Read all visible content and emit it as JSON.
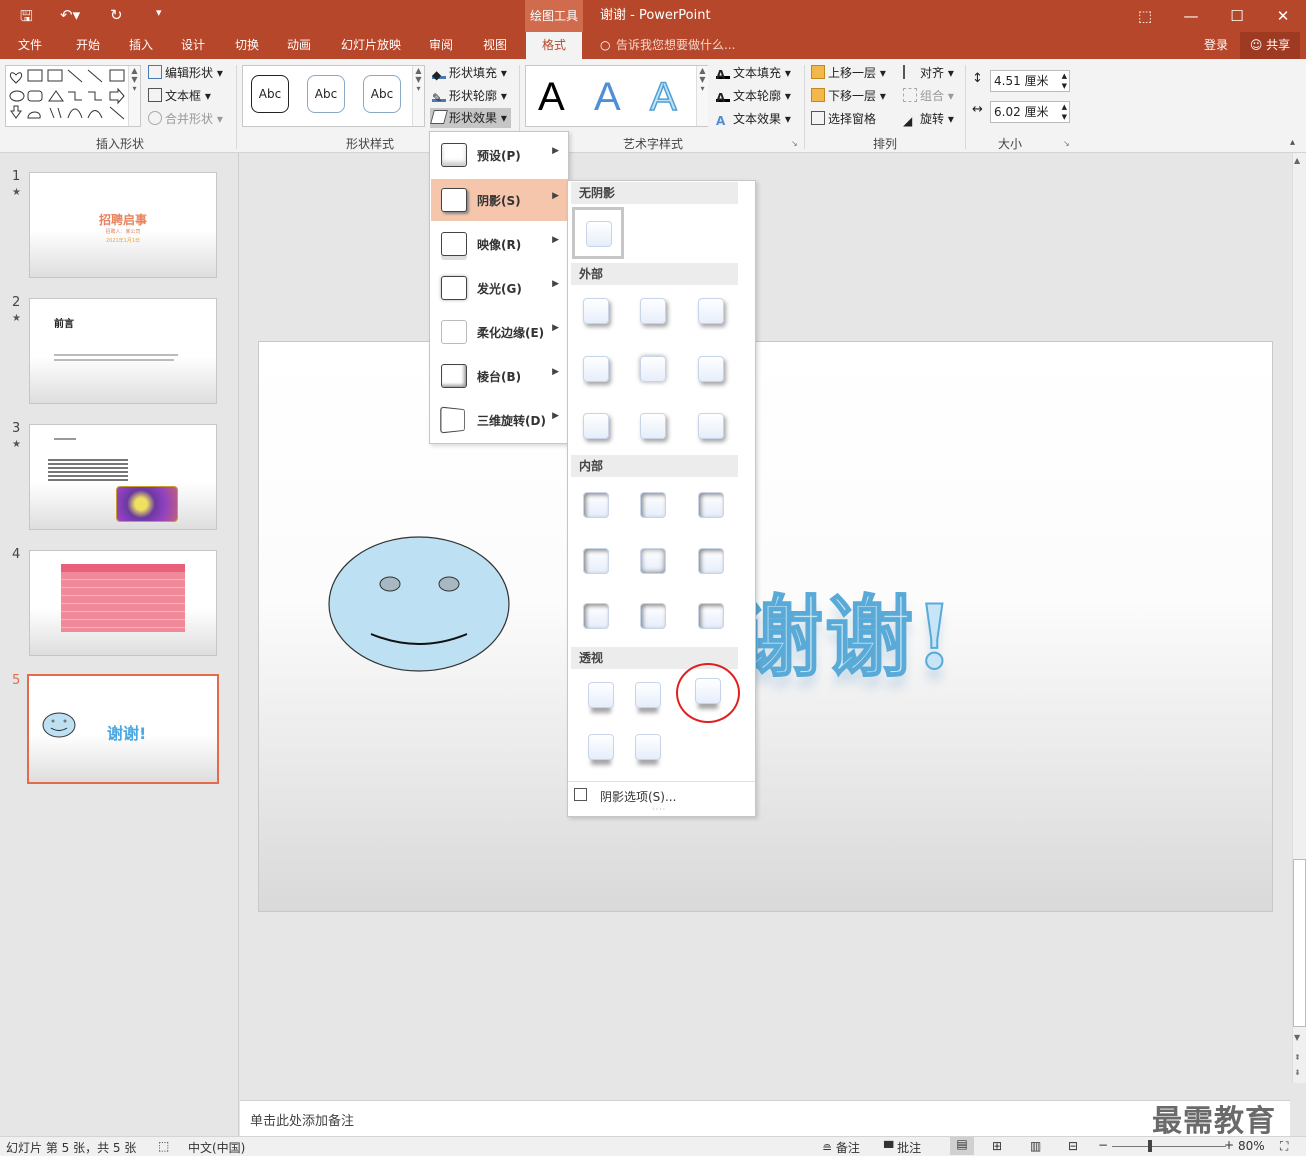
{
  "window": {
    "context_tool": "绘图工具",
    "title": "谢谢 - PowerPoint",
    "login": "登录",
    "share": "共享"
  },
  "tabs": [
    "文件",
    "开始",
    "插入",
    "设计",
    "切换",
    "动画",
    "幻灯片放映",
    "审阅",
    "视图",
    "格式"
  ],
  "active_tab": "格式",
  "tell_me": "告诉我您想要做什么...",
  "ribbon": {
    "insert_shapes": {
      "edit_shape": "编辑形状",
      "text_box": "文本框",
      "merge_shapes": "合并形状",
      "label": "插入形状"
    },
    "shape_styles": {
      "samples": [
        "Abc",
        "Abc",
        "Abc"
      ],
      "fill": "形状填充",
      "outline": "形状轮廓",
      "effects": "形状效果",
      "label": "形状样式"
    },
    "wordart": {
      "samples": [
        "A",
        "A",
        "A"
      ],
      "text_fill": "文本填充",
      "text_outline": "文本轮廓",
      "text_effects": "文本效果",
      "label": "艺术字样式"
    },
    "arrange": {
      "bring_forward": "上移一层",
      "send_backward": "下移一层",
      "selection_pane": "选择窗格",
      "align": "对齐",
      "group": "组合",
      "rotate": "旋转",
      "label": "排列"
    },
    "size": {
      "height": "4.51 厘米",
      "width": "6.02 厘米",
      "label": "大小"
    }
  },
  "effects_menu": [
    "预设(P)",
    "阴影(S)",
    "映像(R)",
    "发光(G)",
    "柔化边缘(E)",
    "棱台(B)",
    "三维旋转(D)"
  ],
  "effects_menu_highlighted": "阴影(S)",
  "shadow_panel": {
    "no_shadow": "无阴影",
    "outer": "外部",
    "inner": "内部",
    "perspective": "透视",
    "options": "阴影选项(S)..."
  },
  "slides": [
    {
      "num": "1",
      "title": "招聘启事",
      "line1": "招聘人：某公司",
      "line2": "2021年1月1日"
    },
    {
      "num": "2",
      "title": "前言"
    },
    {
      "num": "3"
    },
    {
      "num": "4"
    },
    {
      "num": "5",
      "text": "谢谢!"
    }
  ],
  "main_slide": {
    "text": "谢谢!"
  },
  "notes_placeholder": "单击此处添加备注",
  "status": {
    "slide_info": "幻灯片 第 5 张，共 5 张",
    "language": "中文(中国)",
    "notes": "备注",
    "comments": "批注",
    "zoom": "80%"
  },
  "watermark": "最需教育",
  "colors": {
    "accent": "#b7472a",
    "face_fill": "#bde0f3",
    "highlight": "#f5c5ac",
    "circle": "#e02020"
  }
}
